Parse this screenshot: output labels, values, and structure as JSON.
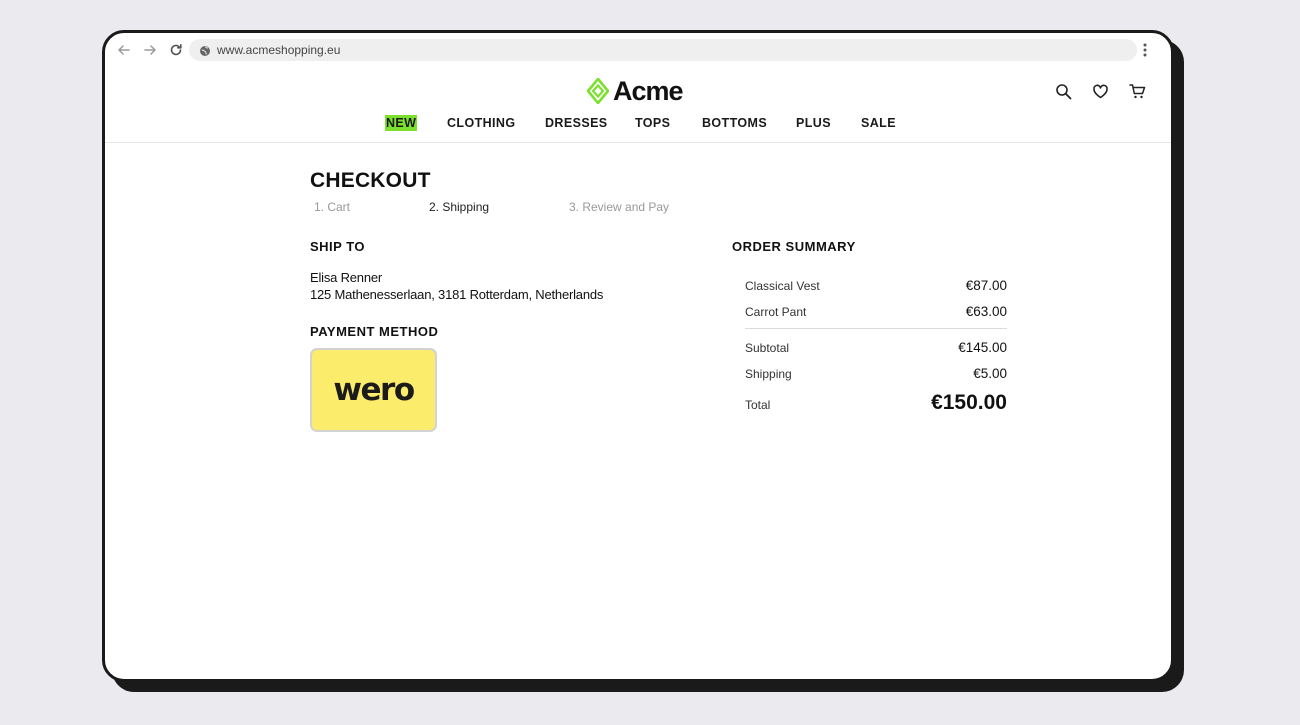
{
  "browser": {
    "url": "www.acmeshopping.eu",
    "icons": [
      "back-arrow-icon",
      "forward-arrow-icon",
      "reload-icon",
      "site-info-icon",
      "more-options-icon"
    ]
  },
  "brand": {
    "name": "Acme",
    "accent_color": "#7be02e"
  },
  "nav": {
    "items": [
      "NEW",
      "CLOTHING",
      "DRESSES",
      "TOPS",
      "BOTTOMS",
      "PLUS",
      "SALE"
    ]
  },
  "header_icons": [
    "search-icon",
    "heart-icon",
    "cart-icon"
  ],
  "checkout": {
    "title": "CHECKOUT",
    "steps": [
      "1. Cart",
      "2. Shipping",
      "3. Review and Pay"
    ],
    "active_step": 1,
    "ship_to": {
      "heading": "SHIP TO",
      "name": "Elisa Renner",
      "address": "125 Mathenesserlaan, 3181 Rotterdam, Netherlands"
    },
    "payment": {
      "heading": "PAYMENT METHOD",
      "method_label": "wero",
      "card_color": "#fbec6c"
    }
  },
  "order_summary": {
    "heading": "ORDER SUMMARY",
    "items": [
      {
        "label": "Classical Vest",
        "value": "€87.00"
      },
      {
        "label": "Carrot Pant",
        "value": "€63.00"
      }
    ],
    "subtotal": {
      "label": "Subtotal",
      "value": "€145.00"
    },
    "shipping": {
      "label": "Shipping",
      "value": "€5.00"
    },
    "total": {
      "label": "Total",
      "value": "€150.00"
    }
  }
}
